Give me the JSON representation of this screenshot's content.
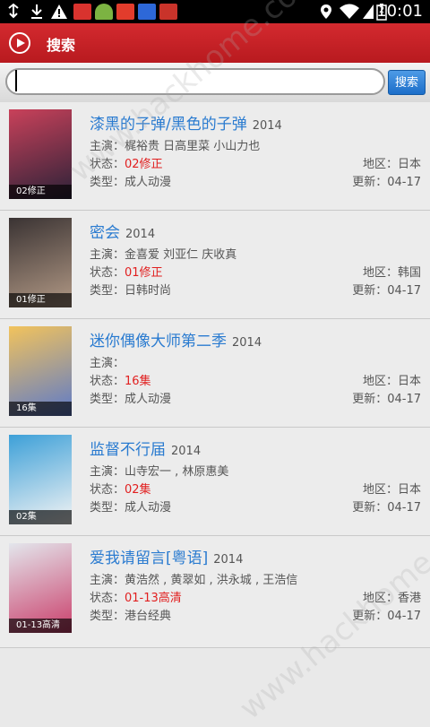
{
  "status_bar": {
    "time": "10:01",
    "battery_level": "2",
    "icons": [
      "usb-icon",
      "download-icon",
      "warning-icon",
      "app1-icon",
      "android-icon",
      "app2-icon",
      "baidu-icon",
      "app3-icon"
    ],
    "right_icons": [
      "location-icon",
      "wifi-icon",
      "signal-icon",
      "battery-icon"
    ]
  },
  "header": {
    "title": "搜索"
  },
  "search": {
    "value": "",
    "placeholder": "",
    "button_label": "搜索"
  },
  "labels": {
    "cast": "主演：",
    "status": "状态：",
    "type": "类型：",
    "region": "地区：",
    "updated": "更新："
  },
  "results": [
    {
      "title": "漆黑的子弹/黑色的子弹",
      "year": "2014",
      "cast": "梶裕贵 日高里菜 小山力也",
      "status": "02修正",
      "type": "成人动漫",
      "region": "日本",
      "updated": "04-17",
      "poster_badge": "02修正",
      "poster_color1": "#c9415a",
      "poster_color2": "#2b2238"
    },
    {
      "title": "密会",
      "year": "2014",
      "cast": "金喜爱 刘亚仁 庆收真",
      "status": "01修正",
      "type": "日韩时尚",
      "region": "韩国",
      "updated": "04-17",
      "poster_badge": "01修正",
      "poster_color1": "#3a3333",
      "poster_color2": "#b39a86"
    },
    {
      "title": "迷你偶像大师第二季",
      "year": "2014",
      "cast": "",
      "status": "16集",
      "type": "成人动漫",
      "region": "日本",
      "updated": "04-17",
      "poster_badge": "16集",
      "poster_color1": "#f2c35c",
      "poster_color2": "#5d7ac9"
    },
    {
      "title": "监督不行届",
      "year": "2014",
      "cast": "山寺宏一 , 林原惠美",
      "status": "02集",
      "type": "成人动漫",
      "region": "日本",
      "updated": "04-17",
      "poster_badge": "02集",
      "poster_color1": "#3da0d8",
      "poster_color2": "#f4f4f4"
    },
    {
      "title": "爱我请留言[粤语]",
      "year": "2014",
      "cast": "黄浩然 , 黄翠如 , 洪永城 , 王浩信",
      "status": "01-13高清",
      "type": "港台经典",
      "region": "香港",
      "updated": "04-17",
      "poster_badge": "01-13高清",
      "poster_color1": "#e3e6ec",
      "poster_color2": "#ca3e6a"
    }
  ],
  "watermark": "www.hackhome.com"
}
